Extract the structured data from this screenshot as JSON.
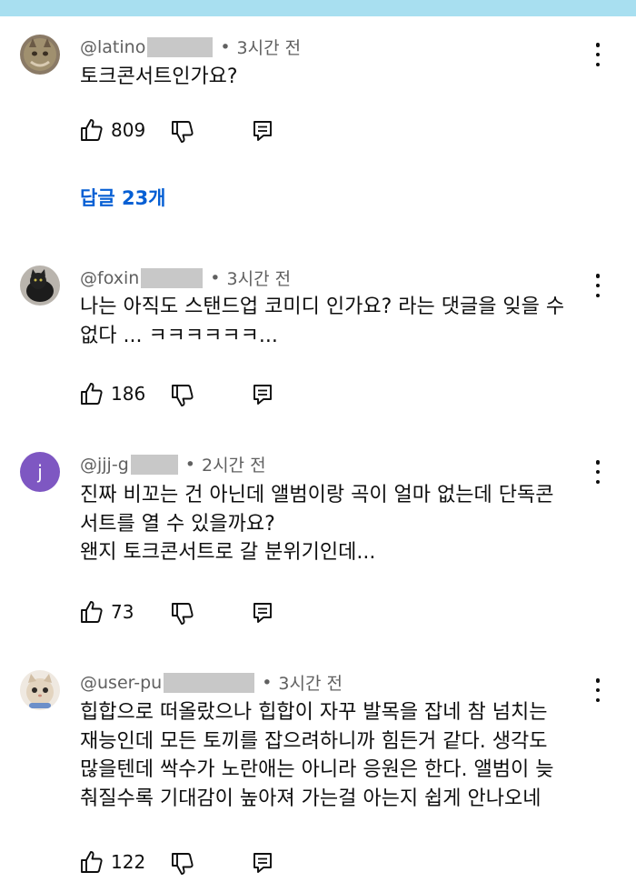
{
  "comments": [
    {
      "username": "@latino",
      "time": "3시간 전",
      "lines": [
        "토크콘서트인가요?"
      ],
      "likes": "809",
      "avatar": "cat-photo-avatar"
    },
    {
      "username": "@foxin",
      "time": "3시간 전",
      "lines": [
        "나는 아직도 스탠드업 코미디 인가요? 라는 댓글을 잊을 수",
        "없다 ... ㅋㅋㅋㅋㅋㅋ..."
      ],
      "likes": "186",
      "avatar": "black-cat-avatar"
    },
    {
      "username": "@jjj-g",
      "time": "2시간 전",
      "lines": [
        "진짜 비꼬는 건 아닌데 앨범이랑 곡이 얼마 없는데 단독콘",
        "서트를 열 수 있을까요?",
        "왠지 토크콘서트로 갈 분위기인데..."
      ],
      "likes": "73",
      "avatar_letter": "j"
    },
    {
      "username": "@user-pu",
      "time": "3시간 전",
      "lines": [
        "힙합으로 떠올랐으나 힙합이 자꾸 발목을 잡네 참 넘치는",
        "재능인데 모든 토끼를 잡으려하니까 힘든거 같다. 생각도",
        "많을텐데 싹수가 노란애는 아니라 응원은 한다. 앨범이 늦",
        "춰질수록 기대감이 높아져 가는걸 아는지 쉽게 안나오네"
      ],
      "likes": "122",
      "avatar": "cat-face-avatar"
    }
  ],
  "replies_label": "답글 23개",
  "colors": {
    "top_bar": "#a8dff0",
    "link": "#065fd4",
    "meta": "#606060",
    "avatar_j": "#7e57c2",
    "redaction": "#c8c8c8"
  }
}
